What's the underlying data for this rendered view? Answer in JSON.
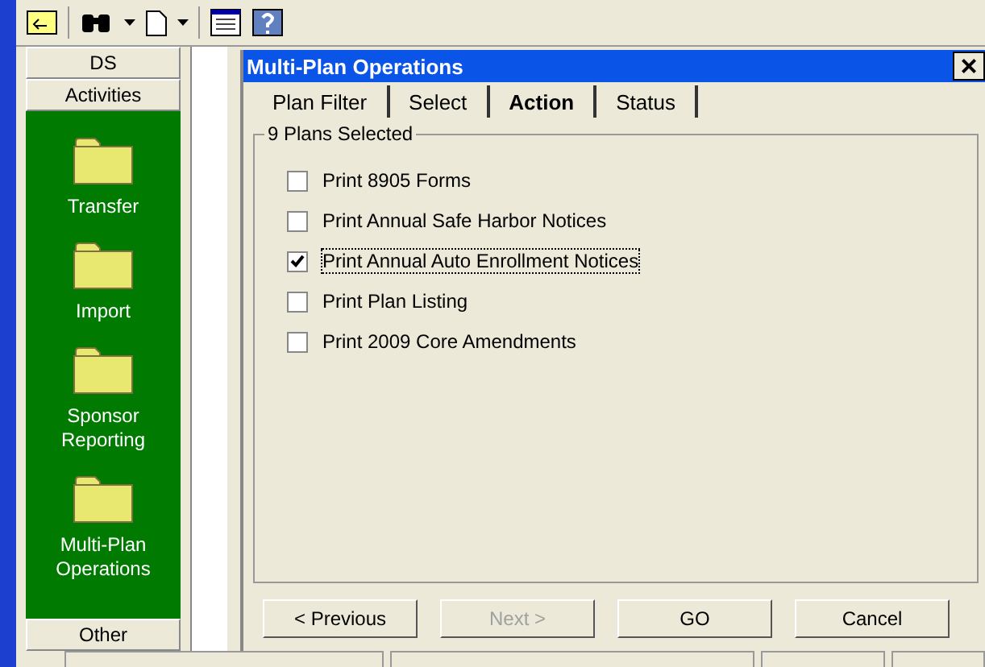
{
  "sidebar": {
    "header": "DS",
    "section": "Activities",
    "items": [
      {
        "label": "Transfer"
      },
      {
        "label": "Import"
      },
      {
        "label": "Sponsor Reporting"
      },
      {
        "label": "Multi-Plan Operations"
      }
    ],
    "footer": "Other"
  },
  "dialog": {
    "title": "Multi-Plan Operations",
    "close": "×",
    "tabs": [
      {
        "label": "Plan Filter",
        "selected": false
      },
      {
        "label": "Select",
        "selected": false
      },
      {
        "label": "Action",
        "selected": true
      },
      {
        "label": "Status",
        "selected": false
      }
    ],
    "group": "9 Plans Selected",
    "options": [
      {
        "label": "Print 8905 Forms",
        "checked": false,
        "focused": false
      },
      {
        "label": "Print Annual Safe Harbor Notices",
        "checked": false,
        "focused": false
      },
      {
        "label": "Print Annual Auto Enrollment Notices",
        "checked": true,
        "focused": true
      },
      {
        "label": "Print Plan Listing",
        "checked": false,
        "focused": false
      },
      {
        "label": "Print 2009 Core Amendments",
        "checked": false,
        "focused": false
      }
    ],
    "buttons": [
      {
        "label": "< Previous",
        "disabled": false
      },
      {
        "label": "Next >",
        "disabled": true
      },
      {
        "label": "GO",
        "disabled": false
      },
      {
        "label": "Cancel",
        "disabled": false
      }
    ]
  }
}
